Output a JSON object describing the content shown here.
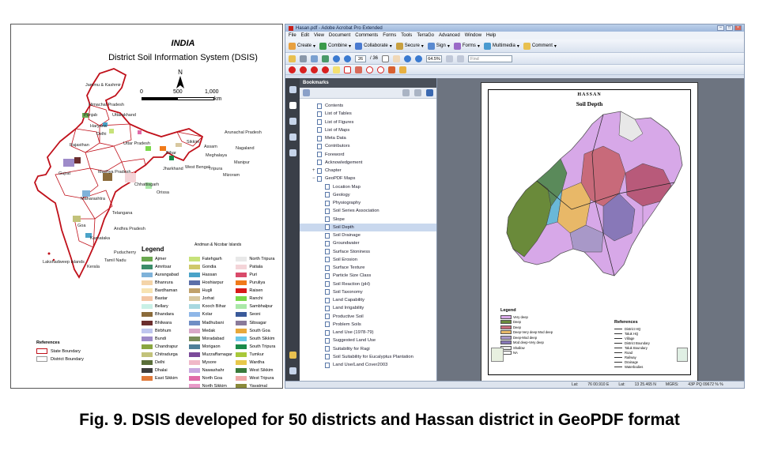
{
  "map": {
    "title_1": "INDIA",
    "title_2": "District Soil Information System (DSIS)",
    "north": "N",
    "scale": {
      "t0": "0",
      "t1": "500",
      "t2": "1,000",
      "unit": "km"
    },
    "states": [
      "Jammu & Kashmir",
      "Himachal Pradesh",
      "Punjab",
      "Uttarakhand",
      "Haryana",
      "Delhi",
      "Rajasthan",
      "Uttar Pradesh",
      "Bihar",
      "Sikkim",
      "Arunachal Pradesh",
      "Assam",
      "Nagaland",
      "Meghalaya",
      "Manipur",
      "Tripura",
      "Mizoram",
      "West Bengal",
      "Jharkhand",
      "Gujrat",
      "Madhya Pradesh",
      "Chhattisgarh",
      "Orissa",
      "Maharashtra",
      "Telangana",
      "Goa",
      "Andhra Pradesh",
      "Karnataka",
      "Tamil Nadu",
      "Kerala",
      "Puducherry",
      "Lakshadweep Islands",
      "Andman & Nicobar Islands"
    ],
    "legend_title": "Legend",
    "legend_col1": [
      {
        "label": "Ajmer",
        "color": "#6aa84f"
      },
      {
        "label": "Amritsar",
        "color": "#3c8d6a"
      },
      {
        "label": "Aurangabad",
        "color": "#7fb2d9"
      },
      {
        "label": "Bhanrura",
        "color": "#f4d4a8"
      },
      {
        "label": "Bardhaman",
        "color": "#f7e3b2"
      },
      {
        "label": "Bastar",
        "color": "#f3c6a5"
      },
      {
        "label": "Bellary",
        "color": "#c9f0e6"
      },
      {
        "label": "Bhandara",
        "color": "#8b6b3a"
      },
      {
        "label": "Bhilwara",
        "color": "#6b2e2e"
      },
      {
        "label": "Birbhum",
        "color": "#bfc6ef"
      },
      {
        "label": "Bundi",
        "color": "#9e8bc9"
      },
      {
        "label": "Chandrapur",
        "color": "#8aa640"
      },
      {
        "label": "Chitradurga",
        "color": "#c2c27a"
      },
      {
        "label": "Delhi",
        "color": "#5a6e3a"
      },
      {
        "label": "Dhalai",
        "color": "#3e3e3e"
      },
      {
        "label": "East  Sikkim",
        "color": "#e07a3a"
      }
    ],
    "legend_col2": [
      {
        "label": "Fatehgarh",
        "color": "#c7e27a"
      },
      {
        "label": "Gondia",
        "color": "#cfc86a"
      },
      {
        "label": "Hassan",
        "color": "#4aa3c8"
      },
      {
        "label": "Hoshiarpur",
        "color": "#5b6fa8"
      },
      {
        "label": "Hugli",
        "color": "#c0a16b"
      },
      {
        "label": "Jorhat",
        "color": "#d8c8a0"
      },
      {
        "label": "Kooch Bihar",
        "color": "#a8d8e0"
      },
      {
        "label": "Kolar",
        "color": "#8fb7e8"
      },
      {
        "label": "Madhubani",
        "color": "#6f8ec4"
      },
      {
        "label": "Medak",
        "color": "#d8a8c8"
      },
      {
        "label": "Moradabad",
        "color": "#7a8e5a"
      },
      {
        "label": "Morigaon",
        "color": "#4e7f98"
      },
      {
        "label": "Muzzaffarnagar",
        "color": "#7b4a9a"
      },
      {
        "label": "Mysore",
        "color": "#f0b8c8"
      },
      {
        "label": "Nawashahr",
        "color": "#c8a8e0"
      },
      {
        "label": "North Goa",
        "color": "#e06aa8"
      },
      {
        "label": "North Sikkim",
        "color": "#e89ac8"
      }
    ],
    "legend_col3": [
      {
        "label": "North Tripura",
        "color": "#e8e8e8"
      },
      {
        "label": "Patiala",
        "color": "#f4d4d8"
      },
      {
        "label": "Puri",
        "color": "#d94a6a"
      },
      {
        "label": "Puruliya",
        "color": "#f07a1a"
      },
      {
        "label": "Raisen",
        "color": "#d81a1a"
      },
      {
        "label": "Ranchi",
        "color": "#7ad84a"
      },
      {
        "label": "Sambhalpur",
        "color": "#aae8a8"
      },
      {
        "label": "Seoni",
        "color": "#3a5a9a"
      },
      {
        "label": "Sibsagar",
        "color": "#8a7a9a"
      },
      {
        "label": "South Goa",
        "color": "#e8a83a"
      },
      {
        "label": "South Sikkim",
        "color": "#6ac8e8"
      },
      {
        "label": "South Tripura",
        "color": "#1a8a4a"
      },
      {
        "label": "Tumkur",
        "color": "#a8c83a"
      },
      {
        "label": "Wardha",
        "color": "#e8c84a"
      },
      {
        "label": "West Sikkim",
        "color": "#3a7a3a"
      },
      {
        "label": "West Tripura",
        "color": "#f0a8a8"
      },
      {
        "label": "Yavatmal",
        "color": "#8a8a3a"
      }
    ],
    "refs_title": "References",
    "ref_1": "State Boundary",
    "ref_2": "District Boundary"
  },
  "acrobat": {
    "title": "Hasan.pdf - Adobe Acrobat Pro Extended",
    "menu": [
      "File",
      "Edit",
      "View",
      "Document",
      "Comments",
      "Forms",
      "Tools",
      "TerraGo",
      "Advanced",
      "Window",
      "Help"
    ],
    "toolbar": [
      "Create",
      "Combine",
      "Collaborate",
      "Secure",
      "Sign",
      "Forms",
      "Multimedia",
      "Comment"
    ],
    "page_current": "26",
    "page_total": "/ 36",
    "zoom": "64.5%",
    "find_placeholder": "Find",
    "bookmarks_header": "Bookmarks",
    "bookmarks": [
      {
        "label": "Contents",
        "level": 0
      },
      {
        "label": "List of Tables",
        "level": 0
      },
      {
        "label": "List of Figures",
        "level": 0
      },
      {
        "label": "List of Maps",
        "level": 0
      },
      {
        "label": "Meta Data",
        "level": 0
      },
      {
        "label": "Contributors",
        "level": 0
      },
      {
        "label": "Foreword",
        "level": 0
      },
      {
        "label": "Acknowledgement",
        "level": 0
      },
      {
        "label": "Chapter",
        "level": 0,
        "expander": "+"
      },
      {
        "label": "GeoPDF Maps",
        "level": 0,
        "expander": "−"
      },
      {
        "label": "Location Map",
        "level": 1
      },
      {
        "label": "Geology",
        "level": 1
      },
      {
        "label": "Physiography",
        "level": 1
      },
      {
        "label": "Soil Series Association",
        "level": 1
      },
      {
        "label": "Slope",
        "level": 1
      },
      {
        "label": "Soil Depth",
        "level": 1,
        "selected": true
      },
      {
        "label": "Soil Drainage",
        "level": 1
      },
      {
        "label": "Groundwater",
        "level": 1
      },
      {
        "label": "Surface Stoniness",
        "level": 1
      },
      {
        "label": "Soil Erosion",
        "level": 1
      },
      {
        "label": "Surface Texture",
        "level": 1
      },
      {
        "label": "Particle Size Class",
        "level": 1
      },
      {
        "label": "Soil Reaction (pH)",
        "level": 1
      },
      {
        "label": "Soil Taxonomy",
        "level": 1
      },
      {
        "label": "Land Capability",
        "level": 1
      },
      {
        "label": "Land Irrigability",
        "level": 1
      },
      {
        "label": "Productive Soil",
        "level": 1
      },
      {
        "label": "Problem Soils",
        "level": 1
      },
      {
        "label": "Land Use (1978-79)",
        "level": 1
      },
      {
        "label": "Suggested Land Use",
        "level": 1
      },
      {
        "label": "Suitability for Ragi",
        "level": 1
      },
      {
        "label": "Soil Suitability for Eucalyptus Plantation",
        "level": 1
      },
      {
        "label": "Land Use/Land Cover2003",
        "level": 1
      }
    ],
    "page_title_1": "HASSAN",
    "page_title_2": "Soil Depth",
    "page_legend_title": "Legend",
    "page_legend": [
      {
        "label": "Very deep",
        "color": "#d9a8e8"
      },
      {
        "label": "Deep",
        "color": "#6a8a3a"
      },
      {
        "label": "Deep",
        "color": "#c86a7a"
      },
      {
        "label": "Deep-Very deep Mod deep",
        "color": "#e8b868"
      },
      {
        "label": "Deep-Mod deep",
        "color": "#a898c8"
      },
      {
        "label": "Mod deep-Very deep",
        "color": "#8878b8"
      },
      {
        "label": "Shallow",
        "color": "#e8e8e8"
      },
      {
        "label": "NA",
        "color": "#ffffff"
      }
    ],
    "page_refs_title": "References",
    "page_refs": [
      "District HQ",
      "Taluk HQ",
      "Village",
      "District Boundary",
      "Taluk Boundary",
      "Road",
      "Railway",
      "Drainage",
      "Waterbodies"
    ],
    "status_left": "Lat:",
    "status_lat": "76 00.910 E",
    "status_lon_lbl": "Lat:",
    "status_lon": "13 25.465 N",
    "status_mgrs": "MGRS:",
    "status_mgrs_val": "43P PQ 09672 % %"
  },
  "caption": "Fig. 9. DSIS developed for 50 districts and Hassan district in GeoPDF format"
}
